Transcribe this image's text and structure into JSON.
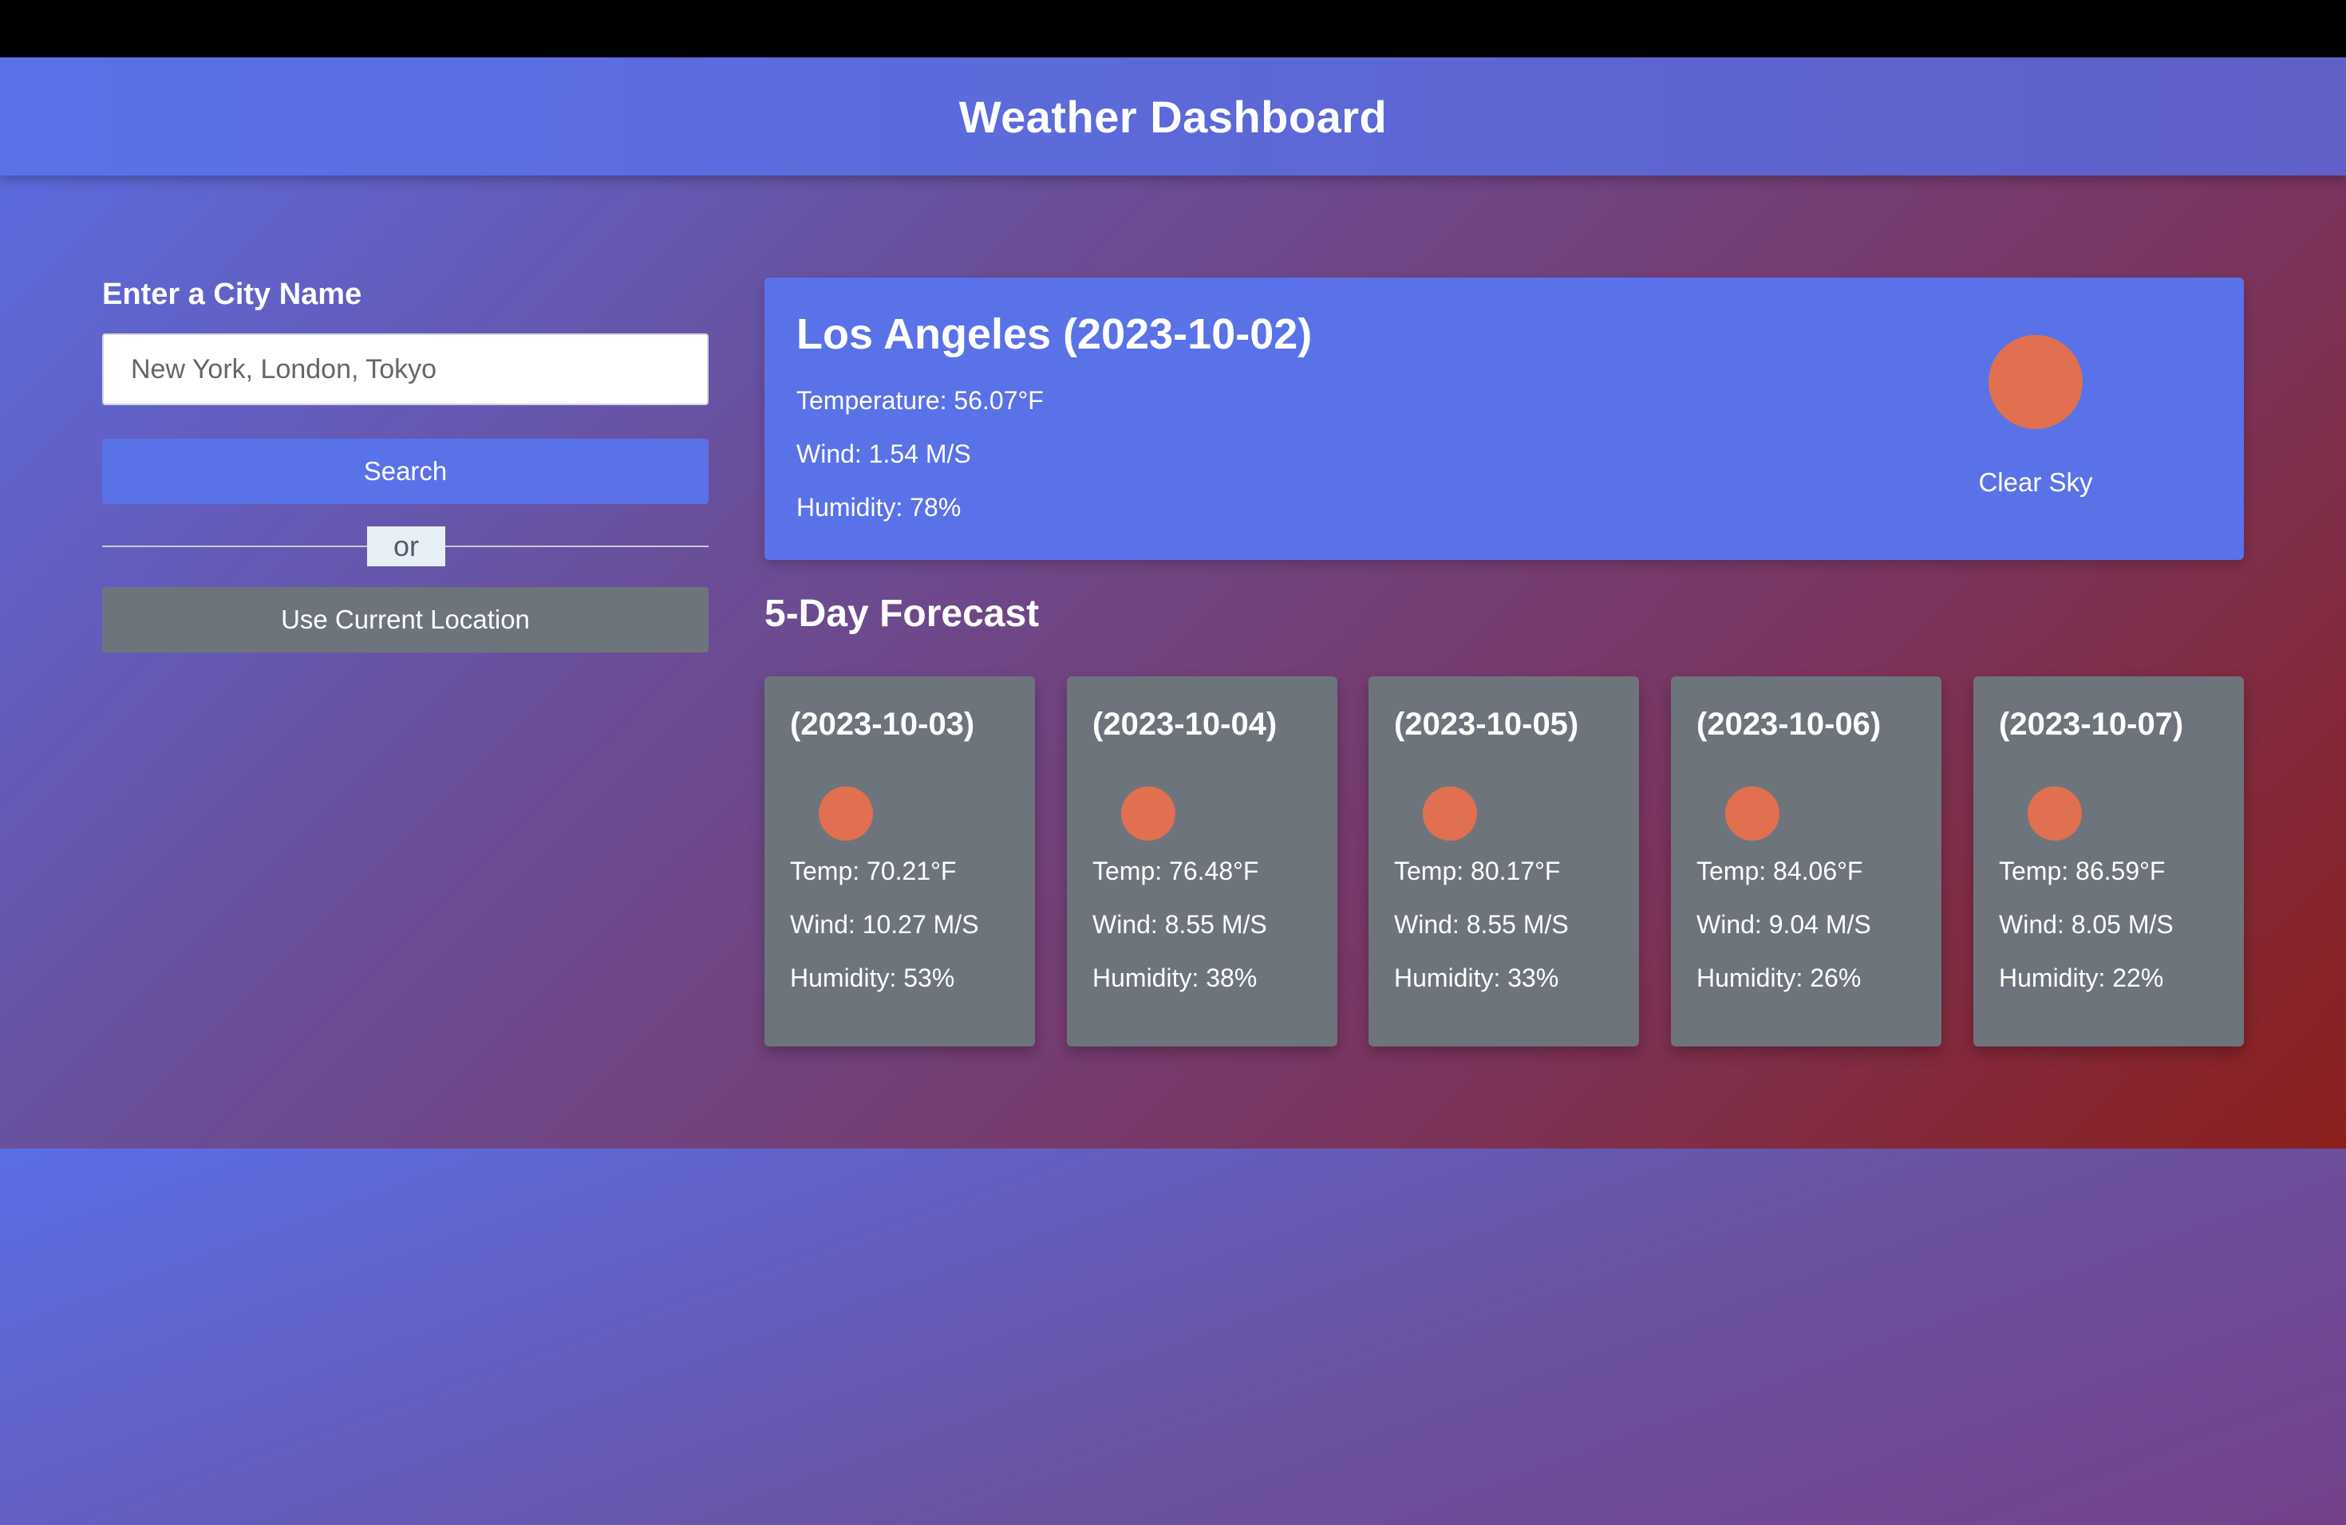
{
  "app": {
    "title": "Weather Dashboard"
  },
  "search": {
    "label": "Enter a City Name",
    "placeholder": "New York, London, Tokyo",
    "value": "",
    "search_button": "Search",
    "or_text": "or",
    "location_button": "Use Current Location"
  },
  "current": {
    "heading": "Los Angeles (2023-10-02)",
    "temperature": "Temperature: 56.07°F",
    "wind": "Wind: 1.54 M/S",
    "humidity": "Humidity: 78%",
    "condition": "Clear Sky",
    "icon": "sun-icon"
  },
  "forecast": {
    "title": "5-Day Forecast",
    "days": [
      {
        "date": "(2023-10-03)",
        "temp": "Temp: 70.21°F",
        "wind": "Wind: 10.27 M/S",
        "humidity": "Humidity: 53%",
        "icon": "sun-icon"
      },
      {
        "date": "(2023-10-04)",
        "temp": "Temp: 76.48°F",
        "wind": "Wind: 8.55 M/S",
        "humidity": "Humidity: 38%",
        "icon": "sun-icon"
      },
      {
        "date": "(2023-10-05)",
        "temp": "Temp: 80.17°F",
        "wind": "Wind: 8.55 M/S",
        "humidity": "Humidity: 33%",
        "icon": "sun-icon"
      },
      {
        "date": "(2023-10-06)",
        "temp": "Temp: 84.06°F",
        "wind": "Wind: 9.04 M/S",
        "humidity": "Humidity: 26%",
        "icon": "sun-icon"
      },
      {
        "date": "(2023-10-07)",
        "temp": "Temp: 86.59°F",
        "wind": "Wind: 8.05 M/S",
        "humidity": "Humidity: 22%",
        "icon": "sun-icon"
      }
    ]
  },
  "colors": {
    "accent": "#5a72e8",
    "secondary_button": "#6e747c",
    "card": "#6e747c",
    "sun": "#e07050"
  }
}
